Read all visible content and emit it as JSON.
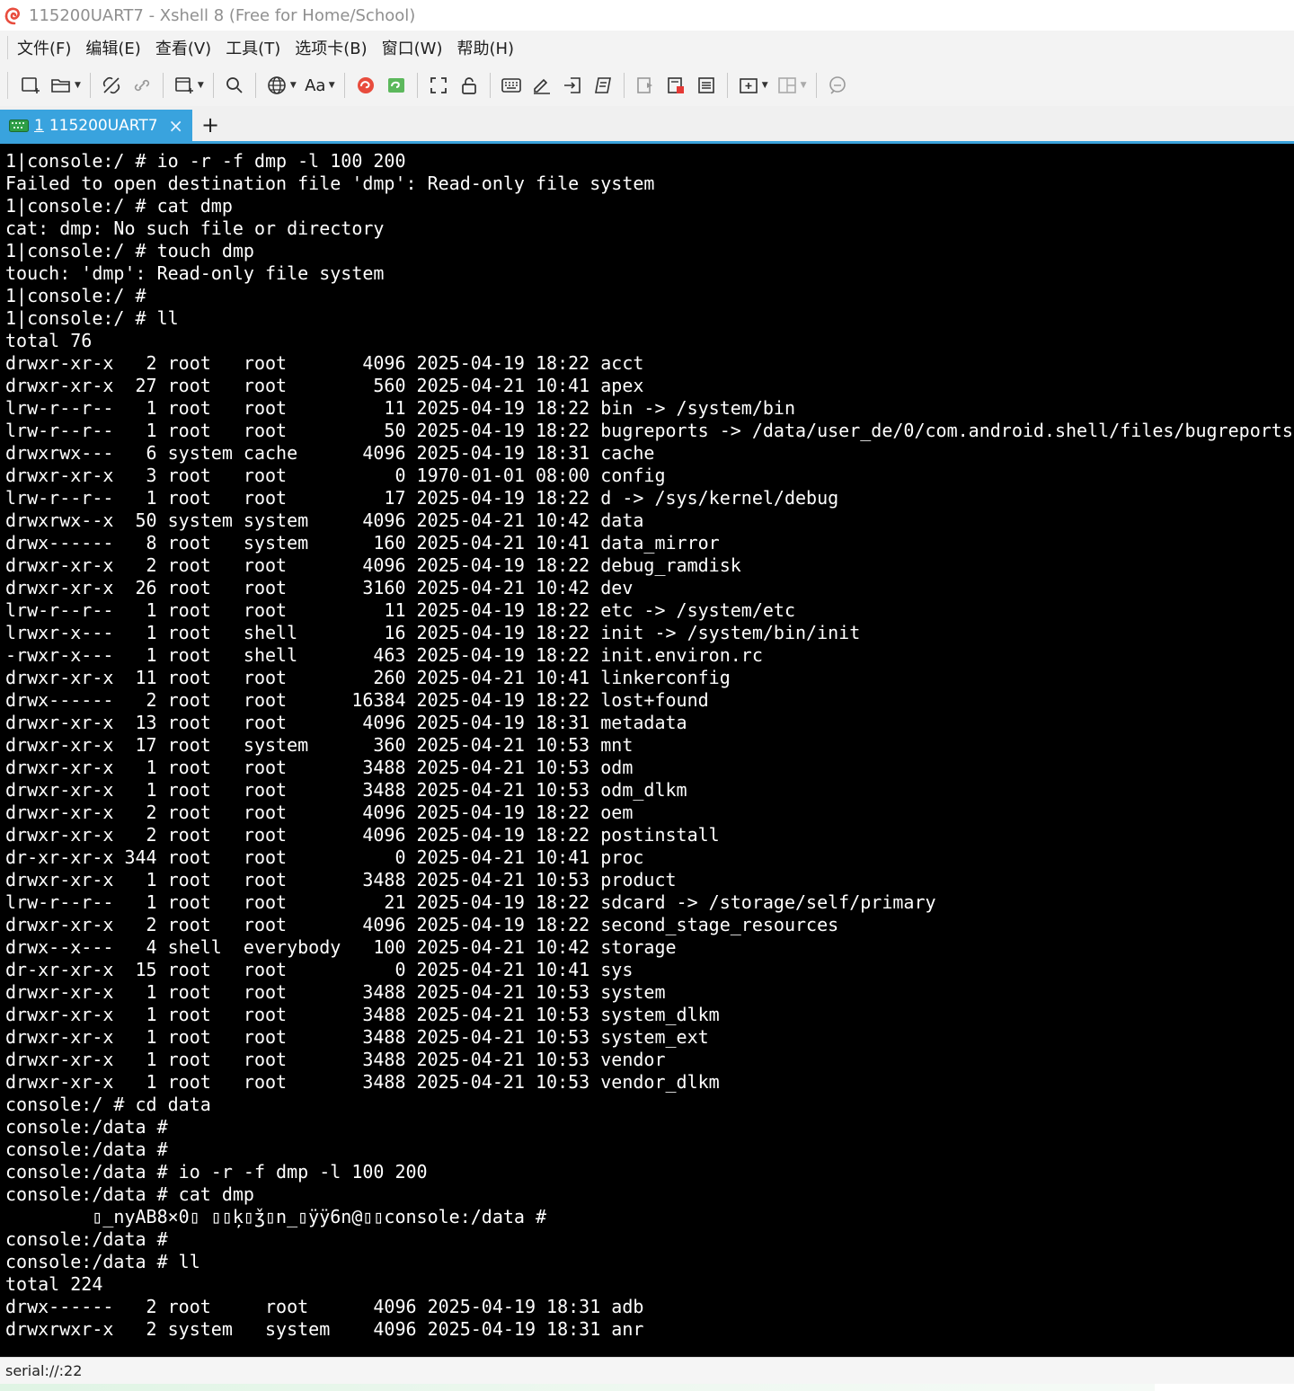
{
  "window": {
    "title": "115200UART7 - Xshell 8 (Free for Home/School)"
  },
  "menu": [
    "文件(F)",
    "编辑(E)",
    "查看(V)",
    "工具(T)",
    "选项卡(B)",
    "窗口(W)",
    "帮助(H)"
  ],
  "toolbar": {
    "font_label": "Aa"
  },
  "tabs": [
    {
      "number": "1",
      "label": "115200UART7",
      "active": true
    }
  ],
  "terminal": {
    "lines": [
      "1|console:/ # io -r -f dmp -l 100 200",
      "Failed to open destination file 'dmp': Read-only file system",
      "1|console:/ # cat dmp",
      "cat: dmp: No such file or directory",
      "1|console:/ # touch dmp",
      "touch: 'dmp': Read-only file system",
      "1|console:/ #",
      "1|console:/ # ll",
      "total 76",
      "drwxr-xr-x   2 root   root       4096 2025-04-19 18:22 acct",
      "drwxr-xr-x  27 root   root        560 2025-04-21 10:41 apex",
      "lrw-r--r--   1 root   root         11 2025-04-19 18:22 bin -> /system/bin",
      "lrw-r--r--   1 root   root         50 2025-04-19 18:22 bugreports -> /data/user_de/0/com.android.shell/files/bugreports",
      "drwxrwx---   6 system cache      4096 2025-04-19 18:31 cache",
      "drwxr-xr-x   3 root   root          0 1970-01-01 08:00 config",
      "lrw-r--r--   1 root   root         17 2025-04-19 18:22 d -> /sys/kernel/debug",
      "drwxrwx--x  50 system system     4096 2025-04-21 10:42 data",
      "drwx------   8 root   system      160 2025-04-21 10:41 data_mirror",
      "drwxr-xr-x   2 root   root       4096 2025-04-19 18:22 debug_ramdisk",
      "drwxr-xr-x  26 root   root       3160 2025-04-21 10:42 dev",
      "lrw-r--r--   1 root   root         11 2025-04-19 18:22 etc -> /system/etc",
      "lrwxr-x---   1 root   shell        16 2025-04-19 18:22 init -> /system/bin/init",
      "-rwxr-x---   1 root   shell       463 2025-04-19 18:22 init.environ.rc",
      "drwxr-xr-x  11 root   root        260 2025-04-21 10:41 linkerconfig",
      "drwx------   2 root   root      16384 2025-04-19 18:22 lost+found",
      "drwxr-xr-x  13 root   root       4096 2025-04-19 18:31 metadata",
      "drwxr-xr-x  17 root   system      360 2025-04-21 10:53 mnt",
      "drwxr-xr-x   1 root   root       3488 2025-04-21 10:53 odm",
      "drwxr-xr-x   1 root   root       3488 2025-04-21 10:53 odm_dlkm",
      "drwxr-xr-x   2 root   root       4096 2025-04-19 18:22 oem",
      "drwxr-xr-x   2 root   root       4096 2025-04-19 18:22 postinstall",
      "dr-xr-xr-x 344 root   root          0 2025-04-21 10:41 proc",
      "drwxr-xr-x   1 root   root       3488 2025-04-21 10:53 product",
      "lrw-r--r--   1 root   root         21 2025-04-19 18:22 sdcard -> /storage/self/primary",
      "drwxr-xr-x   2 root   root       4096 2025-04-19 18:22 second_stage_resources",
      "drwx--x---   4 shell  everybody   100 2025-04-21 10:42 storage",
      "dr-xr-xr-x  15 root   root          0 2025-04-21 10:41 sys",
      "drwxr-xr-x   1 root   root       3488 2025-04-21 10:53 system",
      "drwxr-xr-x   1 root   root       3488 2025-04-21 10:53 system_dlkm",
      "drwxr-xr-x   1 root   root       3488 2025-04-21 10:53 system_ext",
      "drwxr-xr-x   1 root   root       3488 2025-04-21 10:53 vendor",
      "drwxr-xr-x   1 root   root       3488 2025-04-21 10:53 vendor_dlkm",
      "console:/ # cd data",
      "console:/data #",
      "console:/data #",
      "console:/data # io -r -f dmp -l 100 200",
      "console:/data # cat dmp",
      "        ▯_nyAB8×0▯ ▯▯ķ▯ǯ▯n_▯ÿÿ6n@▯▯console:/data #",
      "console:/data #",
      "console:/data # ll",
      "total 224",
      "drwx------   2 root     root      4096 2025-04-19 18:31 adb",
      "drwxrwxr-x   2 system   system    4096 2025-04-19 18:31 anr"
    ]
  },
  "status": {
    "connection": "serial://:22"
  },
  "colors": {
    "tab_active": "#39a3de",
    "terminal_bg": "#000000",
    "terminal_fg": "#ffffff"
  }
}
